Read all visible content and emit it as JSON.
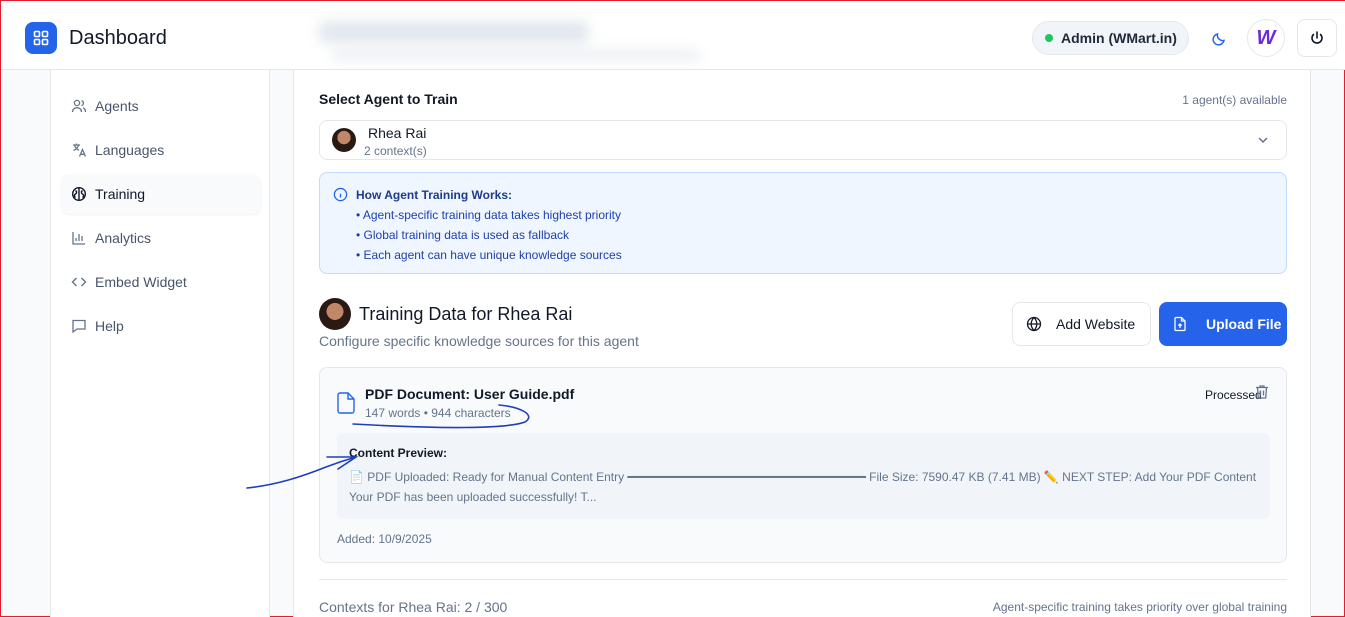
{
  "header": {
    "title": "Dashboard",
    "admin_label": "Admin (WMart.in)",
    "avatar_letter": "W"
  },
  "sidebar": {
    "items": [
      {
        "label": "Agents",
        "icon": "users-icon"
      },
      {
        "label": "Languages",
        "icon": "translate-icon"
      },
      {
        "label": "Training",
        "icon": "brain-icon",
        "active": true
      },
      {
        "label": "Analytics",
        "icon": "bar-chart-icon"
      },
      {
        "label": "Embed Widget",
        "icon": "code-icon"
      },
      {
        "label": "Help",
        "icon": "message-icon"
      }
    ]
  },
  "select": {
    "label": "Select Agent to Train",
    "available": "1 agent(s) available",
    "agent_name": "Rhea Rai",
    "agent_contexts": "2 context(s)"
  },
  "info": {
    "title": "How Agent Training Works:",
    "items": [
      "• Agent-specific training data takes highest priority",
      "• Global training data is used as fallback",
      "• Each agent can have unique knowledge sources"
    ]
  },
  "training": {
    "title": "Training Data for Rhea Rai",
    "subtitle": "Configure specific knowledge sources for this agent",
    "add_website": "Add Website",
    "upload_file": "Upload File"
  },
  "document": {
    "title": "PDF Document: User Guide.pdf",
    "meta": "147 words • 944 characters",
    "status": "Processed",
    "preview_label": "Content Preview:",
    "preview_text": "📄 PDF Uploaded: Ready for Manual Content Entry ━━━━━━━━━━━━━━━━━━━━━━━━━━━━━━━━━ File Size: 7590.47 KB (7.41 MB) ✏️ NEXT STEP: Add Your PDF Content Your PDF has been uploaded successfully! T...",
    "added": "Added: 10/9/2025"
  },
  "footer": {
    "contexts": "Contexts for Rhea Rai: 2 / 300",
    "note": "Agent-specific training takes priority over global training"
  },
  "colors": {
    "accent": "#2563eb",
    "annotation": "#1d3fbf",
    "status_online": "#22c55e"
  }
}
